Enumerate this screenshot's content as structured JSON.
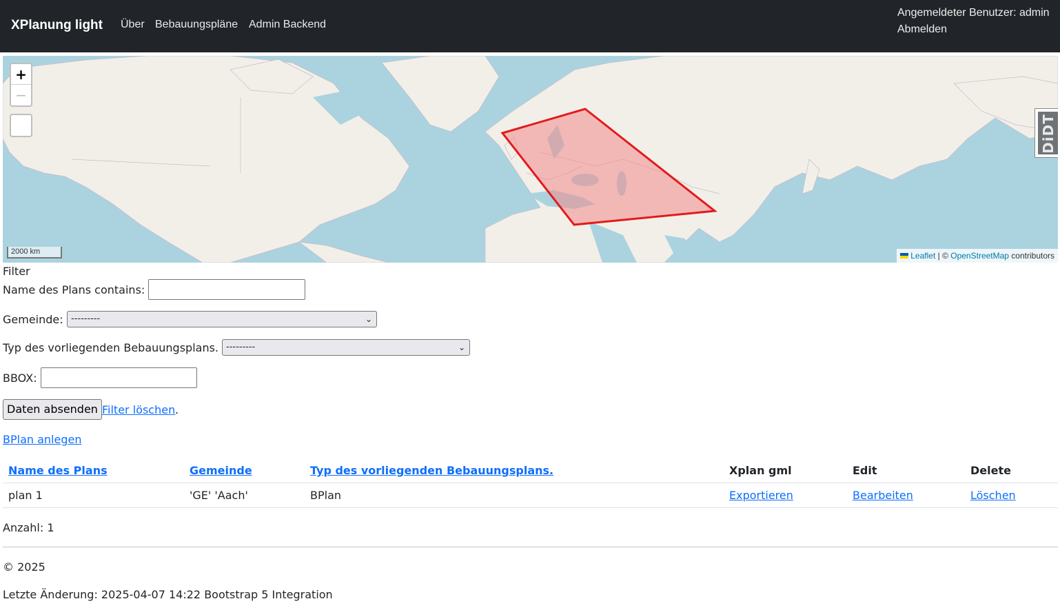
{
  "navbar": {
    "brand": "XPlanung light",
    "links": [
      "Über",
      "Bebauungspläne",
      "Admin Backend"
    ],
    "user_label": "Angemeldeter Benutzer: admin",
    "logout": "Abmelden"
  },
  "map": {
    "zoom_in": "+",
    "zoom_out": "−",
    "scale_label": "2000 km",
    "attribution": {
      "leaflet": "Leaflet",
      "separator": " | © ",
      "osm": "OpenStreetMap",
      "suffix": " contributors"
    },
    "badge": "DiDT",
    "polygon_color": "#e31a1c",
    "polygon_fill": "#f28b8b"
  },
  "filter": {
    "legend": "Filter",
    "name_label": "Name des Plans contains:",
    "name_value": "",
    "gemeinde_label": "Gemeinde:",
    "gemeinde_value": "---------",
    "typ_label": "Typ des vorliegenden Bebauungsplans.",
    "typ_value": "---------",
    "bbox_label": "BBOX:",
    "bbox_value": "",
    "submit": "Daten absenden",
    "clear": "Filter löschen",
    "clear_suffix": "."
  },
  "create_link": "BPlan anlegen",
  "table": {
    "headers": [
      "Name des Plans",
      "Gemeinde",
      "Typ des vorliegenden Bebauungsplans.",
      "Xplan gml",
      "Edit",
      "Delete"
    ],
    "rows": [
      {
        "name": "plan 1",
        "gemeinde": "'GE' 'Aach'",
        "typ": "BPlan",
        "export": "Exportieren",
        "edit": "Bearbeiten",
        "delete": "Löschen"
      }
    ]
  },
  "count": "Anzahl: 1",
  "footer": {
    "copyright": "© 2025",
    "last_change": "Letzte Änderung: 2025-04-07 14:22 Bootstrap 5 Integration"
  },
  "colors": {
    "navbar_bg": "#212529",
    "link": "#0d6efd",
    "sea": "#aad3df",
    "land": "#f2efe9"
  }
}
